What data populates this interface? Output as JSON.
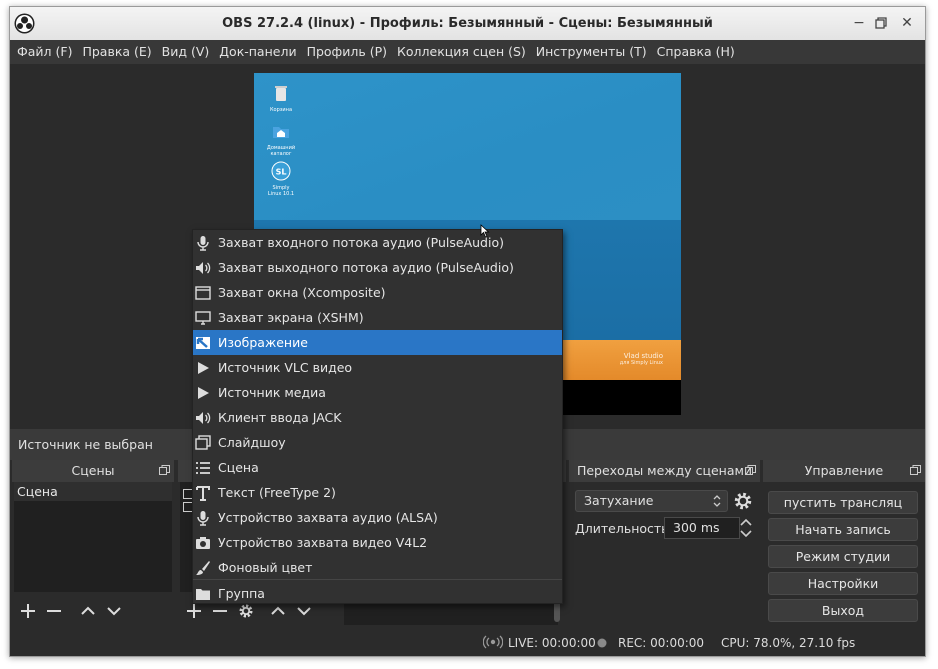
{
  "window": {
    "title": "OBS 27.2.4 (linux) - Профиль: Безымянный - Сцены: Безымянный"
  },
  "menubar": {
    "items": [
      "Файл (F)",
      "Правка (E)",
      "Вид (V)",
      "Док-панели",
      "Профиль (P)",
      "Коллекция сцен (S)",
      "Инструменты (T)",
      "Справка (H)"
    ]
  },
  "desktop": {
    "icons": [
      "Корзина",
      "Домашний каталог",
      "Simply Linux 10.1"
    ],
    "watermark": [
      "Vlad studio",
      "для Simply Linux"
    ]
  },
  "source_status": "Источник не выбран",
  "docks": {
    "scenes": {
      "title": "Сцены",
      "items": [
        "Сцена"
      ]
    },
    "transitions": {
      "title": "Переходы между сценами",
      "selected": "Затухание",
      "duration_label": "Длительность",
      "duration_value": "300 ms"
    },
    "controls": {
      "title": "Управление",
      "buttons": [
        "пустить трансляц",
        "Начать запись",
        "Режим студии",
        "Настройки",
        "Выход"
      ]
    }
  },
  "statusbar": {
    "live": "LIVE: 00:00:00",
    "rec": "REC: 00:00:00",
    "cpu": "CPU: 78.0%, 27.10 fps"
  },
  "context_menu": {
    "items": [
      {
        "label": "Захват входного потока аудио (PulseAudio)",
        "icon": "microphone-icon"
      },
      {
        "label": "Захват выходного потока аудио (PulseAudio)",
        "icon": "speaker-icon"
      },
      {
        "label": "Захват окна (Xcomposite)",
        "icon": "window-icon"
      },
      {
        "label": "Захват экрана (XSHM)",
        "icon": "monitor-icon"
      },
      {
        "label": "Изображение",
        "icon": "image-icon"
      },
      {
        "label": "Источник VLC видео",
        "icon": "play-icon"
      },
      {
        "label": "Источник медиа",
        "icon": "play-icon"
      },
      {
        "label": "Клиент ввода JACK",
        "icon": "speaker-icon"
      },
      {
        "label": "Слайдшоу",
        "icon": "slideshow-icon"
      },
      {
        "label": "Сцена",
        "icon": "list-icon"
      },
      {
        "label": "Текст (FreeType 2)",
        "icon": "text-icon"
      },
      {
        "label": "Устройство захвата аудио (ALSA)",
        "icon": "microphone-icon"
      },
      {
        "label": "Устройство захвата видео V4L2",
        "icon": "camera-icon"
      },
      {
        "label": "Фоновый цвет",
        "icon": "brush-icon"
      },
      {
        "label": "Группа",
        "icon": "folder-icon"
      }
    ],
    "highlighted_index": 4
  },
  "colors": {
    "highlight": "#2a76c6",
    "background": "#2b2b2b",
    "desktop_sky": "#2e93c9",
    "desktop_sea": "#1b6ea5",
    "desktop_sand": "#f0a040"
  }
}
